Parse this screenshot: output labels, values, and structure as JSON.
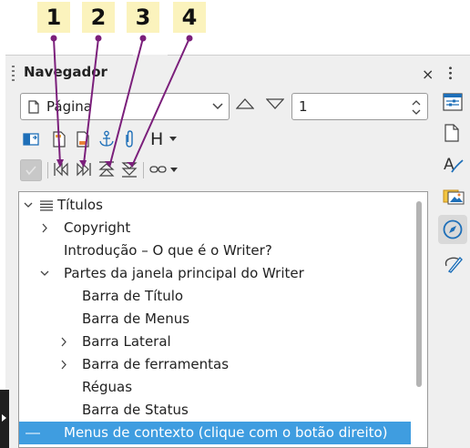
{
  "callouts": [
    "1",
    "2",
    "3",
    "4"
  ],
  "navigator": {
    "title": "Navegador",
    "close_symbol": "×",
    "category_select": {
      "value": "Página",
      "icon": "page-icon"
    },
    "page_number": "1",
    "toolbar": {
      "heading_label": "H",
      "icons": [
        "toggle-icon",
        "header-icon",
        "footer-icon",
        "anchor-icon",
        "attachment-icon",
        "heading-icon",
        "content-view-icon",
        "previous-icon",
        "next-icon",
        "promote-level-icon",
        "demote-level-icon",
        "drag-mode-icon"
      ]
    },
    "tree": {
      "items": [
        {
          "label": "Títulos",
          "level": 0,
          "expander": "expanded"
        },
        {
          "label": "Copyright",
          "level": 1,
          "expander": "collapsed"
        },
        {
          "label": "Introdução – O que é o Writer?",
          "level": 1,
          "expander": "none"
        },
        {
          "label": "Partes da janela principal do Writer",
          "level": 1,
          "expander": "expanded"
        },
        {
          "label": "Barra de Título",
          "level": 2,
          "expander": "none"
        },
        {
          "label": "Barra de Menus",
          "level": 2,
          "expander": "none"
        },
        {
          "label": "Barra Lateral",
          "level": 2,
          "expander": "collapsed"
        },
        {
          "label": "Barra de ferramentas",
          "level": 2,
          "expander": "collapsed"
        },
        {
          "label": "Réguas",
          "level": 2,
          "expander": "none"
        },
        {
          "label": "Barra de Status",
          "level": 2,
          "expander": "none"
        },
        {
          "label": "Menus de contexto (clique com o botão direito)",
          "level": 1,
          "expander": "none",
          "selected": true
        }
      ]
    }
  },
  "sidebar_tabs": [
    "properties-icon",
    "page-icon",
    "styles-icon",
    "gallery-icon",
    "navigator-icon",
    "manage-changes-icon"
  ],
  "colors": {
    "selection": "#3f9de0",
    "callout_bg": "#fbf3bd",
    "callout_line": "#7b1f7b",
    "sidebar_accent": "#1e6fb8"
  }
}
